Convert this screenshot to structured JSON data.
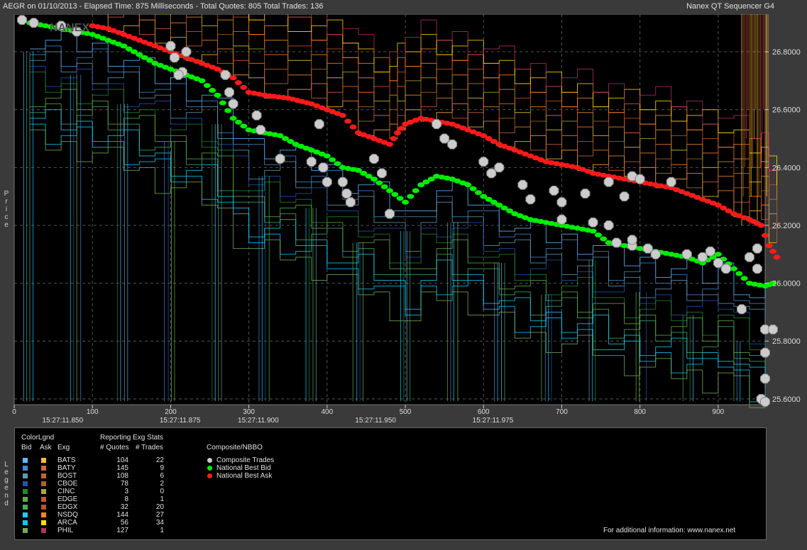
{
  "header": {
    "left": "AEGR on 01/10/2013  -  Elapsed Time: 875 Milliseconds  -  Total Quotes: 805  Total Trades: 136",
    "right": "Nanex QT Sequencer G4"
  },
  "watermark": "NANEX",
  "chart_data": {
    "type": "scatter",
    "ylabel": "Price",
    "ylim": [
      25.58,
      26.93
    ],
    "xlim": [
      0,
      960
    ],
    "y_ticks": [
      "26.8000",
      "26.6000",
      "26.4000",
      "26.2000",
      "26.0000",
      "25.8000",
      "25.6000"
    ],
    "x_ticks": [
      "0",
      "100",
      "200",
      "300",
      "400",
      "500",
      "600",
      "700",
      "800",
      "900"
    ],
    "x_time_labels": [
      {
        "x": 62,
        "label": "15:27:11.850"
      },
      {
        "x": 212,
        "label": "15:27:11.875"
      },
      {
        "x": 312,
        "label": "15:27:11.900"
      },
      {
        "x": 462,
        "label": "15:27:11.950"
      },
      {
        "x": 612,
        "label": "15:27:11.975"
      }
    ],
    "series": [
      {
        "name": "National Best Ask",
        "color": "#ff1a1a",
        "points": [
          [
            100,
            26.89
          ],
          [
            120,
            26.88
          ],
          [
            140,
            26.86
          ],
          [
            160,
            26.84
          ],
          [
            180,
            26.82
          ],
          [
            200,
            26.8
          ],
          [
            220,
            26.78
          ],
          [
            240,
            26.76
          ],
          [
            260,
            26.74
          ],
          [
            280,
            26.71
          ],
          [
            300,
            26.66
          ],
          [
            320,
            26.65
          ],
          [
            350,
            26.64
          ],
          [
            380,
            26.62
          ],
          [
            400,
            26.6
          ],
          [
            420,
            26.58
          ],
          [
            440,
            26.52
          ],
          [
            460,
            26.5
          ],
          [
            480,
            26.48
          ],
          [
            490,
            26.52
          ],
          [
            500,
            26.55
          ],
          [
            520,
            26.57
          ],
          [
            540,
            26.56
          ],
          [
            560,
            26.55
          ],
          [
            580,
            26.53
          ],
          [
            600,
            26.51
          ],
          [
            620,
            26.48
          ],
          [
            640,
            26.46
          ],
          [
            660,
            26.44
          ],
          [
            680,
            26.42
          ],
          [
            700,
            26.41
          ],
          [
            720,
            26.4
          ],
          [
            740,
            26.38
          ],
          [
            760,
            26.37
          ],
          [
            780,
            26.36
          ],
          [
            800,
            26.35
          ],
          [
            820,
            26.34
          ],
          [
            840,
            26.33
          ],
          [
            860,
            26.31
          ],
          [
            880,
            26.29
          ],
          [
            900,
            26.27
          ],
          [
            920,
            26.24
          ],
          [
            940,
            26.22
          ],
          [
            955,
            26.2
          ],
          [
            965,
            26.13
          ],
          [
            975,
            26.09
          ]
        ]
      },
      {
        "name": "National Best Bid",
        "color": "#00ee00",
        "points": [
          [
            20,
            26.9
          ],
          [
            40,
            26.89
          ],
          [
            60,
            26.88
          ],
          [
            80,
            26.87
          ],
          [
            100,
            26.86
          ],
          [
            120,
            26.84
          ],
          [
            140,
            26.82
          ],
          [
            160,
            26.79
          ],
          [
            180,
            26.76
          ],
          [
            200,
            26.74
          ],
          [
            220,
            26.72
          ],
          [
            240,
            26.7
          ],
          [
            260,
            26.65
          ],
          [
            280,
            26.57
          ],
          [
            300,
            26.53
          ],
          [
            320,
            26.52
          ],
          [
            340,
            26.51
          ],
          [
            360,
            26.48
          ],
          [
            380,
            26.46
          ],
          [
            400,
            26.44
          ],
          [
            420,
            26.4
          ],
          [
            440,
            26.39
          ],
          [
            460,
            26.36
          ],
          [
            480,
            26.32
          ],
          [
            500,
            26.28
          ],
          [
            520,
            26.34
          ],
          [
            540,
            26.37
          ],
          [
            560,
            26.36
          ],
          [
            580,
            26.34
          ],
          [
            600,
            26.3
          ],
          [
            620,
            26.27
          ],
          [
            640,
            26.24
          ],
          [
            660,
            26.22
          ],
          [
            680,
            26.21
          ],
          [
            700,
            26.2
          ],
          [
            720,
            26.19
          ],
          [
            740,
            26.18
          ],
          [
            760,
            26.14
          ],
          [
            780,
            26.13
          ],
          [
            800,
            26.12
          ],
          [
            820,
            26.11
          ],
          [
            840,
            26.1
          ],
          [
            860,
            26.09
          ],
          [
            880,
            26.07
          ],
          [
            900,
            26.1
          ],
          [
            920,
            26.05
          ],
          [
            940,
            26.0
          ],
          [
            960,
            25.99
          ],
          [
            970,
            26.0
          ],
          [
            960,
            25.76
          ]
        ]
      },
      {
        "name": "Composite Trades",
        "color": "#cccccc",
        "points": [
          [
            10,
            26.91
          ],
          [
            25,
            26.9
          ],
          [
            60,
            26.89
          ],
          [
            80,
            26.87
          ],
          [
            200,
            26.82
          ],
          [
            220,
            26.8
          ],
          [
            205,
            26.78
          ],
          [
            215,
            26.73
          ],
          [
            210,
            26.72
          ],
          [
            270,
            26.72
          ],
          [
            275,
            26.66
          ],
          [
            280,
            26.62
          ],
          [
            310,
            26.58
          ],
          [
            315,
            26.53
          ],
          [
            390,
            26.55
          ],
          [
            340,
            26.43
          ],
          [
            380,
            26.42
          ],
          [
            395,
            26.4
          ],
          [
            400,
            26.35
          ],
          [
            420,
            26.35
          ],
          [
            425,
            26.31
          ],
          [
            430,
            26.28
          ],
          [
            460,
            26.43
          ],
          [
            470,
            26.38
          ],
          [
            480,
            26.24
          ],
          [
            540,
            26.55
          ],
          [
            550,
            26.5
          ],
          [
            560,
            26.48
          ],
          [
            600,
            26.42
          ],
          [
            610,
            26.38
          ],
          [
            620,
            26.4
          ],
          [
            650,
            26.34
          ],
          [
            660,
            26.29
          ],
          [
            690,
            26.32
          ],
          [
            700,
            26.28
          ],
          [
            700,
            26.22
          ],
          [
            730,
            26.31
          ],
          [
            740,
            26.21
          ],
          [
            760,
            26.2
          ],
          [
            770,
            26.14
          ],
          [
            790,
            26.13
          ],
          [
            810,
            26.12
          ],
          [
            820,
            26.1
          ],
          [
            790,
            26.37
          ],
          [
            800,
            26.36
          ],
          [
            760,
            26.35
          ],
          [
            780,
            26.3
          ],
          [
            790,
            26.15
          ],
          [
            840,
            26.35
          ],
          [
            860,
            26.1
          ],
          [
            880,
            26.09
          ],
          [
            890,
            26.11
          ],
          [
            900,
            26.07
          ],
          [
            910,
            26.05
          ],
          [
            930,
            25.91
          ],
          [
            950,
            26.12
          ],
          [
            950,
            26.05
          ],
          [
            940,
            26.09
          ],
          [
            960,
            25.84
          ],
          [
            970,
            25.84
          ],
          [
            960,
            25.76
          ],
          [
            960,
            25.67
          ],
          [
            955,
            25.6
          ],
          [
            960,
            25.59
          ]
        ]
      }
    ]
  },
  "legend": {
    "side_label": "Legend",
    "colorlgnd_title": "ColorLgnd",
    "stats_title": "Reporting Exg Stats",
    "headers": {
      "bid": "Bid",
      "ask": "Ask",
      "exg": "Exg",
      "quotes": "# Quotes",
      "trades": "# Trades"
    },
    "exchanges": [
      {
        "exg": "BATS",
        "quotes": "104",
        "trades": "22",
        "bid_color": "#66bbff",
        "ask_color": "#ffbb44"
      },
      {
        "exg": "BATY",
        "quotes": "145",
        "trades": "9",
        "bid_color": "#4488cc",
        "ask_color": "#cc6644"
      },
      {
        "exg": "BOST",
        "quotes": "108",
        "trades": "6",
        "bid_color": "#6699aa",
        "ask_color": "#bb6633"
      },
      {
        "exg": "CBOE",
        "quotes": "78",
        "trades": "2",
        "bid_color": "#2255aa",
        "ask_color": "#aa6622"
      },
      {
        "exg": "CINC",
        "quotes": "3",
        "trades": "0",
        "bid_color": "#228833",
        "ask_color": "#aaaa33"
      },
      {
        "exg": "EDGE",
        "quotes": "8",
        "trades": "1",
        "bid_color": "#66aa44",
        "ask_color": "#cc5533"
      },
      {
        "exg": "EDGX",
        "quotes": "32",
        "trades": "20",
        "bid_color": "#44aa66",
        "ask_color": "#bb5522"
      },
      {
        "exg": "NSDQ",
        "quotes": "144",
        "trades": "27",
        "bid_color": "#22ccee",
        "ask_color": "#ff8822"
      },
      {
        "exg": "ARCA",
        "quotes": "56",
        "trades": "34",
        "bid_color": "#00ccff",
        "ask_color": "#ffdd00"
      },
      {
        "exg": "PHIL",
        "quotes": "127",
        "trades": "1",
        "bid_color": "#77aa55",
        "ask_color": "#aa3366"
      }
    ],
    "composite_title": "Composite/NBBO",
    "composite_items": [
      {
        "label": "Composite Trades",
        "color": "#cccccc"
      },
      {
        "label": "National Best Bid",
        "color": "#00ee00"
      },
      {
        "label": "National Best Ask",
        "color": "#ff1a1a"
      }
    ],
    "footer": "For additional information: www.nanex.net"
  }
}
